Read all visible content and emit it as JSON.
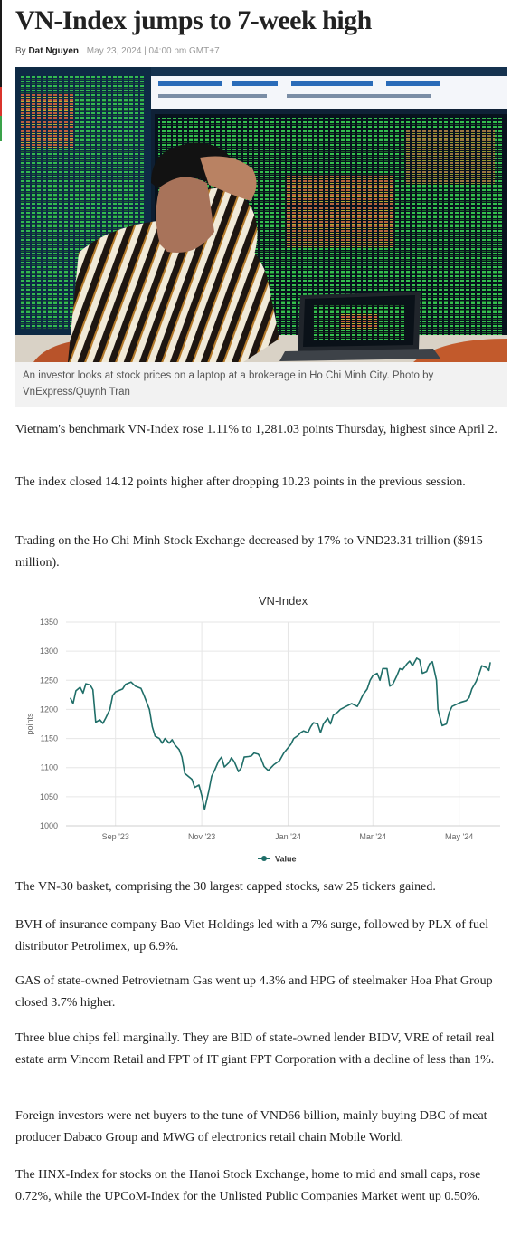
{
  "article": {
    "title": "VN-Index jumps to 7-week high",
    "byline_prefix": "By",
    "author": "Dat Nguyen",
    "date": "May 23, 2024 | 04:00 pm GMT+7"
  },
  "photo": {
    "caption": "An investor looks at stock prices on a laptop at a brokerage in Ho Chi Minh City. Photo by VnExpress/Quynh Tran"
  },
  "paragraphs": [
    "Vietnam's benchmark VN-Index rose 1.11% to 1,281.03 points Thursday, highest since April 2.",
    "The index closed 14.12 points higher after dropping 10.23 points in the previous session.",
    "Trading on the Ho Chi Minh Stock Exchange decreased by 17% to VND23.31 trillion ($915 million).",
    "The VN-30 basket, comprising the 30 largest capped stocks, saw 25 tickers gained.",
    "BVH of insurance company Bao Viet Holdings led with a 7% surge, followed by PLX of fuel distributor Petrolimex, up 6.9%.",
    "GAS of state-owned Petrovietnam Gas went up 4.3% and HPG of steelmaker Hoa Phat Group closed 3.7% higher.",
    "Three blue chips fell marginally. They are BID of state-owned lender BIDV, VRE of retail real estate arm Vincom Retail and FPT of IT giant FPT Corporation with a decline of less than 1%.",
    "Foreign investors were net buyers to the tune of VND66 billion, mainly buying DBC of meat producer Dabaco Group and MWG of electronics retail chain Mobile World.",
    "The HNX-Index for stocks on the Hanoi Stock Exchange, home to mid and small caps, rose 0.72%, while the UPCoM-Index for the Unlisted Public Companies Market went up 0.50%."
  ],
  "colors": {
    "line": "#1f6e68",
    "grid": "#e6e6e6",
    "accent_bars": [
      "#1a1a1a",
      "#d9342b",
      "#3aa24a"
    ]
  },
  "chart_data": {
    "type": "line",
    "title": "VN-Index",
    "xlabel": "",
    "ylabel": "points",
    "ylim": [
      1000,
      1350
    ],
    "yticks": [
      "1000",
      "1050",
      "1100",
      "1150",
      "1200",
      "1250",
      "1300",
      "1350"
    ],
    "xticks": [
      {
        "label": "Sep '23",
        "date": "2023-09-01"
      },
      {
        "label": "Nov '23",
        "date": "2023-11-01"
      },
      {
        "label": "Jan '24",
        "date": "2024-01-01"
      },
      {
        "label": "Mar '24",
        "date": "2024-03-01"
      },
      {
        "label": "May '24",
        "date": "2024-05-01"
      }
    ],
    "grid": true,
    "legend": "bottom-center",
    "series": [
      {
        "name": "Value",
        "color": "#1f6e68",
        "points": [
          [
            "2023-07-31",
            1220
          ],
          [
            "2023-08-02",
            1210
          ],
          [
            "2023-08-04",
            1232
          ],
          [
            "2023-08-07",
            1238
          ],
          [
            "2023-08-09",
            1228
          ],
          [
            "2023-08-11",
            1244
          ],
          [
            "2023-08-14",
            1242
          ],
          [
            "2023-08-16",
            1234
          ],
          [
            "2023-08-18",
            1178
          ],
          [
            "2023-08-21",
            1182
          ],
          [
            "2023-08-23",
            1176
          ],
          [
            "2023-08-25",
            1185
          ],
          [
            "2023-08-28",
            1200
          ],
          [
            "2023-08-30",
            1224
          ],
          [
            "2023-09-01",
            1230
          ],
          [
            "2023-09-06",
            1235
          ],
          [
            "2023-09-08",
            1243
          ],
          [
            "2023-09-12",
            1247
          ],
          [
            "2023-09-15",
            1240
          ],
          [
            "2023-09-19",
            1236
          ],
          [
            "2023-09-21",
            1225
          ],
          [
            "2023-09-25",
            1200
          ],
          [
            "2023-09-27",
            1170
          ],
          [
            "2023-09-29",
            1154
          ],
          [
            "2023-10-02",
            1150
          ],
          [
            "2023-10-04",
            1142
          ],
          [
            "2023-10-06",
            1150
          ],
          [
            "2023-10-09",
            1142
          ],
          [
            "2023-10-11",
            1148
          ],
          [
            "2023-10-13",
            1139
          ],
          [
            "2023-10-16",
            1131
          ],
          [
            "2023-10-18",
            1118
          ],
          [
            "2023-10-20",
            1090
          ],
          [
            "2023-10-23",
            1084
          ],
          [
            "2023-10-25",
            1080
          ],
          [
            "2023-10-27",
            1066
          ],
          [
            "2023-10-30",
            1070
          ],
          [
            "2023-11-01",
            1052
          ],
          [
            "2023-11-02",
            1040
          ],
          [
            "2023-11-03",
            1028
          ],
          [
            "2023-11-06",
            1060
          ],
          [
            "2023-11-08",
            1085
          ],
          [
            "2023-11-10",
            1095
          ],
          [
            "2023-11-13",
            1112
          ],
          [
            "2023-11-15",
            1118
          ],
          [
            "2023-11-17",
            1101
          ],
          [
            "2023-11-20",
            1108
          ],
          [
            "2023-11-22",
            1117
          ],
          [
            "2023-11-24",
            1110
          ],
          [
            "2023-11-27",
            1093
          ],
          [
            "2023-11-29",
            1100
          ],
          [
            "2023-12-01",
            1118
          ],
          [
            "2023-12-04",
            1119
          ],
          [
            "2023-12-06",
            1120
          ],
          [
            "2023-12-08",
            1125
          ],
          [
            "2023-12-11",
            1123
          ],
          [
            "2023-12-13",
            1115
          ],
          [
            "2023-12-15",
            1102
          ],
          [
            "2023-12-18",
            1095
          ],
          [
            "2023-12-20",
            1100
          ],
          [
            "2023-12-22",
            1105
          ],
          [
            "2023-12-26",
            1112
          ],
          [
            "2023-12-29",
            1125
          ],
          [
            "2024-01-03",
            1140
          ],
          [
            "2024-01-05",
            1150
          ],
          [
            "2024-01-08",
            1155
          ],
          [
            "2024-01-10",
            1160
          ],
          [
            "2024-01-12",
            1163
          ],
          [
            "2024-01-15",
            1160
          ],
          [
            "2024-01-17",
            1170
          ],
          [
            "2024-01-19",
            1177
          ],
          [
            "2024-01-22",
            1175
          ],
          [
            "2024-01-24",
            1160
          ],
          [
            "2024-01-26",
            1175
          ],
          [
            "2024-01-29",
            1185
          ],
          [
            "2024-01-31",
            1175
          ],
          [
            "2024-02-02",
            1190
          ],
          [
            "2024-02-05",
            1195
          ],
          [
            "2024-02-07",
            1200
          ],
          [
            "2024-02-15",
            1210
          ],
          [
            "2024-02-19",
            1205
          ],
          [
            "2024-02-21",
            1215
          ],
          [
            "2024-02-23",
            1225
          ],
          [
            "2024-02-26",
            1235
          ],
          [
            "2024-02-28",
            1250
          ],
          [
            "2024-03-01",
            1258
          ],
          [
            "2024-03-04",
            1262
          ],
          [
            "2024-03-06",
            1250
          ],
          [
            "2024-03-08",
            1270
          ],
          [
            "2024-03-11",
            1270
          ],
          [
            "2024-03-13",
            1240
          ],
          [
            "2024-03-15",
            1243
          ],
          [
            "2024-03-18",
            1258
          ],
          [
            "2024-03-20",
            1270
          ],
          [
            "2024-03-22",
            1268
          ],
          [
            "2024-03-25",
            1278
          ],
          [
            "2024-03-27",
            1283
          ],
          [
            "2024-03-29",
            1275
          ],
          [
            "2024-04-01",
            1288
          ],
          [
            "2024-04-03",
            1285
          ],
          [
            "2024-04-05",
            1262
          ],
          [
            "2024-04-08",
            1265
          ],
          [
            "2024-04-10",
            1278
          ],
          [
            "2024-04-12",
            1282
          ],
          [
            "2024-04-15",
            1250
          ],
          [
            "2024-04-16",
            1200
          ],
          [
            "2024-04-17",
            1190
          ],
          [
            "2024-04-19",
            1172
          ],
          [
            "2024-04-22",
            1175
          ],
          [
            "2024-04-24",
            1195
          ],
          [
            "2024-04-26",
            1205
          ],
          [
            "2024-05-02",
            1212
          ],
          [
            "2024-05-06",
            1215
          ],
          [
            "2024-05-08",
            1220
          ],
          [
            "2024-05-10",
            1235
          ],
          [
            "2024-05-13",
            1248
          ],
          [
            "2024-05-15",
            1260
          ],
          [
            "2024-05-17",
            1275
          ],
          [
            "2024-05-20",
            1272
          ],
          [
            "2024-05-21",
            1270
          ],
          [
            "2024-05-22",
            1267
          ],
          [
            "2024-05-23",
            1281
          ]
        ]
      }
    ]
  }
}
